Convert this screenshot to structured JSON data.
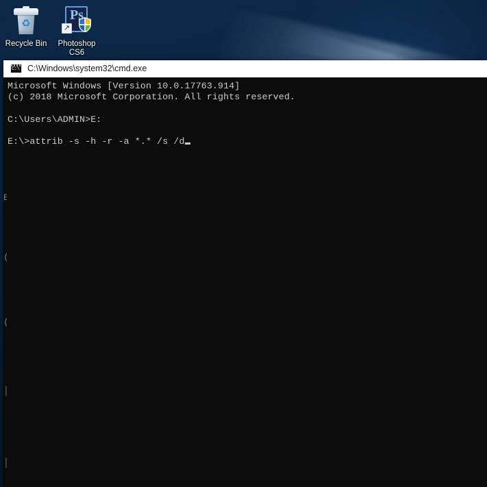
{
  "desktop": {
    "wallpaper_color": "#0a2340",
    "icons": [
      {
        "id": "recycle-bin",
        "label": "Recycle Bin",
        "icon": "recycle-bin-icon",
        "recycle_glyph": "♻"
      },
      {
        "id": "photoshop-cs6",
        "label": "Photoshop CS6",
        "icon": "photoshop-icon",
        "letters": "Ps",
        "shortcut_glyph": "↗",
        "badge": "shield-icon",
        "square_color": "#17224a",
        "letter_color": "#8fc4ef",
        "border_color": "#5f9fe0"
      }
    ]
  },
  "cmd_window": {
    "title": "C:\\Windows\\system32\\cmd.exe",
    "icon": "cmd-icon",
    "icon_text": "C:\\",
    "titlebar_bg": "#ffffff",
    "titlebar_fg": "#1b1b1b",
    "console_bg": "#0c0c0c",
    "console_fg": "#cccccc",
    "lines": [
      "Microsoft Windows [Version 10.0.17763.914]",
      "(c) 2018 Microsoft Corporation. All rights reserved.",
      "",
      "C:\\Users\\ADMIN>E:",
      "",
      "E:\\>attrib -s -h -r -a *.* /s /d"
    ],
    "cursor": "block",
    "ghost_fragments": [
      "E",
      "(",
      "(",
      "│",
      "│"
    ]
  }
}
